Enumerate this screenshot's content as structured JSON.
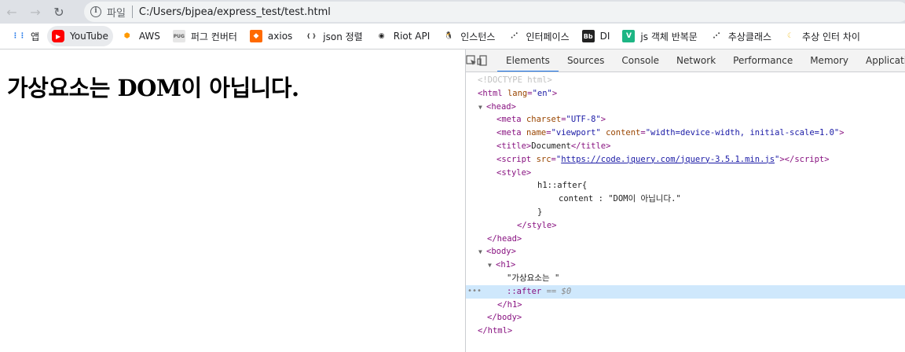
{
  "browser": {
    "file_label": "파일",
    "url": "C:/Users/bjpea/express_test/test.html"
  },
  "bookmarks": [
    {
      "label": "앱",
      "icon": "apps-grid-icon",
      "color": "#1a73e8"
    },
    {
      "label": "YouTube",
      "icon": "youtube-icon",
      "color": "#ff0000"
    },
    {
      "label": "AWS",
      "icon": "aws-cube-icon",
      "color": "#ff9900"
    },
    {
      "label": "퍼그 컨버터",
      "icon": "pug-icon",
      "color": "#5a5a5a"
    },
    {
      "label": "axios",
      "icon": "axios-icon",
      "color": "#ff6a00"
    },
    {
      "label": "json 정렬",
      "icon": "json-icon",
      "color": "#333333"
    },
    {
      "label": "Riot API",
      "icon": "riot-icon",
      "color": "#222222"
    },
    {
      "label": "인스턴스",
      "icon": "linux-icon",
      "color": "#222222"
    },
    {
      "label": "인터페이스",
      "icon": "dots-icon",
      "color": "#333333"
    },
    {
      "label": "DI",
      "icon": "bb-icon",
      "color": "#333333"
    },
    {
      "label": "js 객체 반복문",
      "icon": "v-icon",
      "color": "#1db584"
    },
    {
      "label": "추상클래스",
      "icon": "dots-icon",
      "color": "#333333"
    },
    {
      "label": "추상 인터 차이",
      "icon": "moon-icon",
      "color": "#f2c94c"
    }
  ],
  "page": {
    "h1_text": "가상요소는 ",
    "h1_after": "DOM이 아닙니다."
  },
  "devtools": {
    "tabs": [
      "Elements",
      "Sources",
      "Console",
      "Network",
      "Performance",
      "Memory",
      "Application"
    ],
    "active_tab": "Elements",
    "doctype": "<!DOCTYPE html>",
    "html_open": "html",
    "lang_attr": "lang",
    "lang_val": "\"en\"",
    "head": "head",
    "meta1_attr": "charset",
    "meta1_val": "\"UTF-8\"",
    "meta2_name_attr": "name",
    "meta2_name_val": "\"viewport\"",
    "meta2_content_attr": "content",
    "meta2_content_val": "\"width=device-width, initial-scale=1.0\"",
    "title_text": "Document",
    "script_attr": "src",
    "script_src": "https://code.jquery.com/jquery-3.5.1.min.js",
    "style_line1": "h1::after{",
    "style_line2": "content : \"DOM이 아닙니다.\"",
    "style_line3": "}",
    "body": "body",
    "h1": "h1",
    "h1_text": "\"가상요소는 \"",
    "after_pseudo": "::after",
    "after_eq": "== $0"
  }
}
